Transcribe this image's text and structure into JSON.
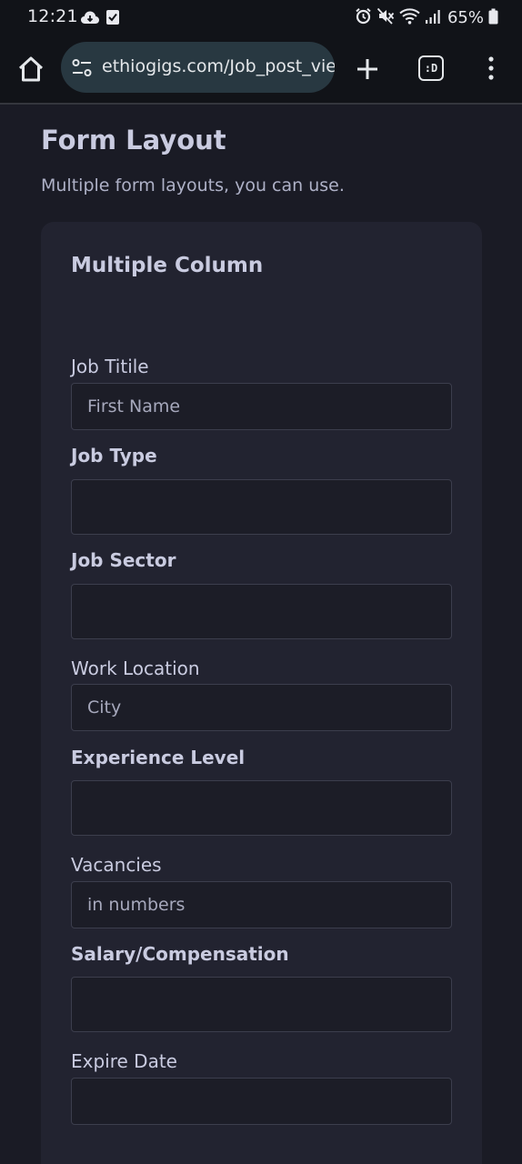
{
  "status_bar": {
    "time": "12:21",
    "battery": "65%",
    "left_icons": [
      "cloud-icon",
      "checkbox-icon"
    ],
    "right_icons": [
      "alarm-icon",
      "mute-icon",
      "wifi-icon",
      "signal-icon",
      "battery-icon"
    ]
  },
  "browser": {
    "url": "ethiogigs.com/Job_post_vie",
    "icons": [
      "home-icon",
      "site-settings-icon",
      "new-tab-icon",
      "tabs-icon",
      "menu-icon"
    ],
    "tabs_label": ":D"
  },
  "page": {
    "title": "Form Layout",
    "subtitle": "Multiple form layouts, you can use."
  },
  "card": {
    "title": "Multiple Column"
  },
  "form": {
    "job_title_label": "Job Titile",
    "job_title_placeholder": "First Name",
    "job_type_label": "Job Type",
    "job_sector_label": "Job Sector",
    "work_location_label": "Work Location",
    "work_location_placeholder": "City",
    "experience_level_label": "Experience Level",
    "vacancies_label": "Vacancies",
    "vacancies_placeholder": "in numbers",
    "salary_label": "Salary/Compensation",
    "expire_date_label": "Expire Date"
  },
  "colors": {
    "background": "#1a1b25",
    "card": "#222330",
    "input": "#1c1d27",
    "input_border": "#3c3e4d",
    "text": "#c9cbe0",
    "chrome": "#111318",
    "url_pill": "#283841"
  }
}
